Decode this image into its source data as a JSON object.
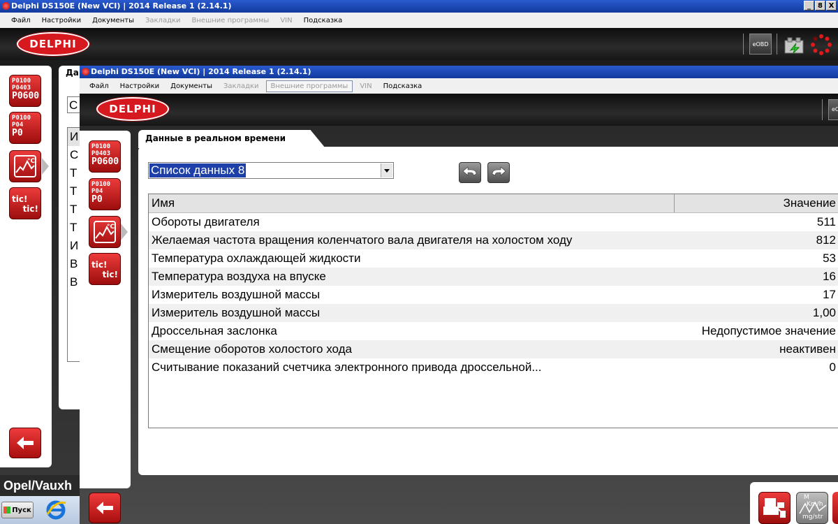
{
  "outer_window": {
    "title": "Delphi DS150E (New VCI) | 2014 Release 1 (2.14.1)",
    "menu": [
      {
        "label": "Файл",
        "disabled": false
      },
      {
        "label": "Настройки",
        "disabled": false
      },
      {
        "label": "Документы",
        "disabled": false
      },
      {
        "label": "Закладки",
        "disabled": true
      },
      {
        "label": "Внешние программы",
        "disabled": true
      },
      {
        "label": "VIN",
        "disabled": true
      },
      {
        "label": "Подсказка",
        "disabled": false
      }
    ],
    "logo": "DELPHI",
    "eobd_label": "eOBD",
    "tab_partial": "Да",
    "combo_partial": "С",
    "list_partial": [
      "И",
      "С",
      "Т",
      "Т",
      "Т",
      "Т",
      "И",
      "В",
      "В"
    ],
    "vehicle": "Opel/Vauxh",
    "window_controls": [
      "_",
      "8",
      "X"
    ]
  },
  "sidebar_icons": {
    "dtc_codes": [
      "P0100",
      "P0403",
      "P0600"
    ],
    "dtc_clear": [
      "P0100",
      "P04",
      "P0"
    ],
    "ticks": [
      "tic!",
      "tic!"
    ]
  },
  "taskbar": {
    "start_label": "Пуск"
  },
  "inner_window": {
    "title": "Delphi DS150E (New VCI) | 2014 Release 1 (2.14.1)",
    "menu": [
      {
        "label": "Файл",
        "style": "normal"
      },
      {
        "label": "Настройки",
        "style": "normal"
      },
      {
        "label": "Документы",
        "style": "normal"
      },
      {
        "label": "Закладки",
        "style": "disabled"
      },
      {
        "label": "Внешние программы",
        "style": "boxed"
      },
      {
        "label": "VIN",
        "style": "disabled"
      },
      {
        "label": "Подсказка",
        "style": "normal"
      }
    ],
    "logo": "DELPHI",
    "eobd_partial": "eO",
    "tab_label": "Данные в реальном времени",
    "dropdown_value": "Список данных 8",
    "table": {
      "headers": [
        "Имя",
        "Значение"
      ],
      "rows": [
        {
          "name": "Обороты двигателя",
          "value": "511"
        },
        {
          "name": "Желаемая частота вращения коленчатого вала двигателя на холостом ходу",
          "value": "812"
        },
        {
          "name": "Температура охлаждающей жидкости",
          "value": "53"
        },
        {
          "name": "Температура воздуха на впуске",
          "value": "16"
        },
        {
          "name": "Измеритель воздушной массы",
          "value": "17"
        },
        {
          "name": "Измеритель воздушной массы",
          "value": "1,00"
        },
        {
          "name": "Дроссельная заслонка",
          "value": "Недопустимое значение"
        },
        {
          "name": "Смещение оборотов холостого хода",
          "value": "неактивен"
        },
        {
          "name": "Считывание показаний счетчика электронного привода дроссельной...",
          "value": "0"
        }
      ]
    },
    "bottom_icon_text": [
      "M",
      "Km/h",
      "mg/str"
    ]
  },
  "colors": {
    "delphi_red": "#d6191f",
    "selection_blue": "#1c3fa8",
    "title_blue": "#1f4bbd"
  }
}
